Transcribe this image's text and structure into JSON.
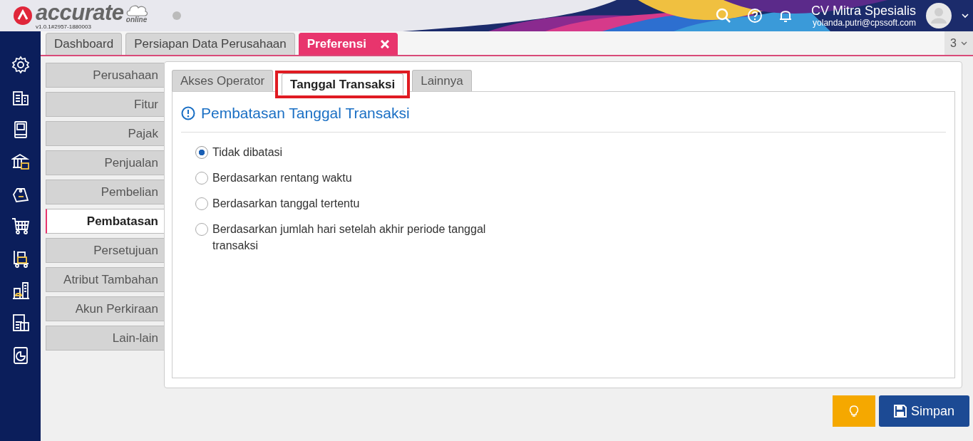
{
  "header": {
    "logo_text": "accurate",
    "logo_sub": "online",
    "version": "v1.0.1#2957-1880003",
    "company": "CV Mitra Spesialis",
    "email": "yolanda.putri@cpssoft.com"
  },
  "tabs": [
    {
      "label": "Dashboard",
      "selected": false,
      "closable": false
    },
    {
      "label": "Persiapan Data Perusahaan",
      "selected": false,
      "closable": false
    },
    {
      "label": "Preferensi",
      "selected": true,
      "closable": true
    }
  ],
  "tab_count": "3",
  "pref_menu": [
    {
      "label": "Perusahaan",
      "selected": false
    },
    {
      "label": "Fitur",
      "selected": false
    },
    {
      "label": "Pajak",
      "selected": false
    },
    {
      "label": "Penjualan",
      "selected": false
    },
    {
      "label": "Pembelian",
      "selected": false
    },
    {
      "label": "Pembatasan",
      "selected": true
    },
    {
      "label": "Persetujuan",
      "selected": false
    },
    {
      "label": "Atribut Tambahan",
      "selected": false
    },
    {
      "label": "Akun Perkiraan",
      "selected": false
    },
    {
      "label": "Lain-lain",
      "selected": false
    }
  ],
  "sub_tabs": [
    {
      "label": "Akses Operator",
      "selected": false,
      "highlighted": false
    },
    {
      "label": "Tanggal Transaksi",
      "selected": true,
      "highlighted": true
    },
    {
      "label": "Lainnya",
      "selected": false,
      "highlighted": false
    }
  ],
  "section_title": "Pembatasan Tanggal Transaksi",
  "options": [
    {
      "label": "Tidak dibatasi",
      "selected": true
    },
    {
      "label": "Berdasarkan rentang waktu",
      "selected": false
    },
    {
      "label": "Berdasarkan tanggal tertentu",
      "selected": false
    },
    {
      "label": "Berdasarkan jumlah hari setelah akhir periode tanggal transaksi",
      "selected": false
    }
  ],
  "save_button": "Simpan"
}
